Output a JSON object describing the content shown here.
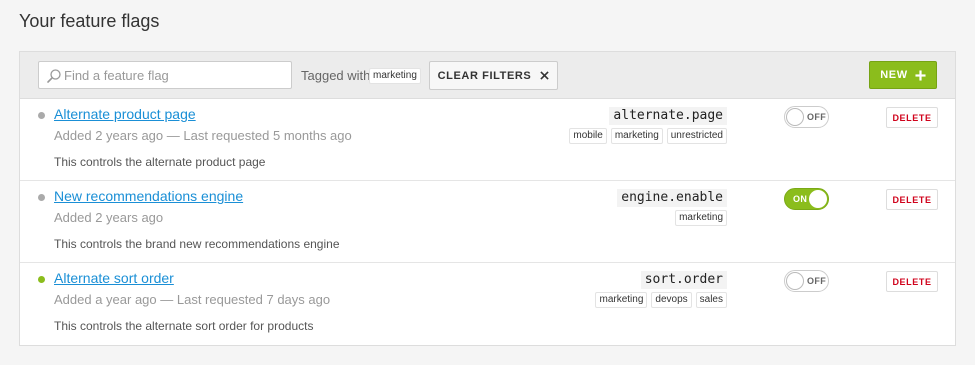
{
  "page": {
    "title": "Your feature flags"
  },
  "toolbar": {
    "search_placeholder": "Find a feature flag",
    "search_value": "",
    "tagged_label": "Tagged with",
    "active_tag": "marketing",
    "clear_filters_label": "CLEAR FILTERS",
    "new_label": "NEW"
  },
  "colors": {
    "accent_green": "#8bbd1c",
    "link_blue": "#1a8fd6",
    "delete_red": "#d0021b",
    "status_inactive": "#aaaaaa",
    "status_active": "#8bbd1c"
  },
  "flags": [
    {
      "name": "Alternate product page",
      "meta": "Added 2 years ago — Last requested 5 months ago",
      "description": "This controls the alternate product page",
      "key": "alternate.page",
      "tags": [
        "mobile",
        "marketing",
        "unrestricted"
      ],
      "toggle_state": "off",
      "toggle_label": "OFF",
      "status": "inactive",
      "delete_label": "DELETE"
    },
    {
      "name": "New recommendations engine",
      "meta": "Added 2 years ago",
      "description": "This controls the brand new recommendations engine",
      "key": "engine.enable",
      "tags": [
        "marketing"
      ],
      "toggle_state": "on",
      "toggle_label": "ON",
      "status": "inactive",
      "delete_label": "DELETE"
    },
    {
      "name": "Alternate sort order",
      "meta": "Added a year ago — Last requested 7 days ago",
      "description": "This controls the alternate sort order for products",
      "key": "sort.order",
      "tags": [
        "marketing",
        "devops",
        "sales"
      ],
      "toggle_state": "off",
      "toggle_label": "OFF",
      "status": "active",
      "delete_label": "DELETE"
    }
  ]
}
